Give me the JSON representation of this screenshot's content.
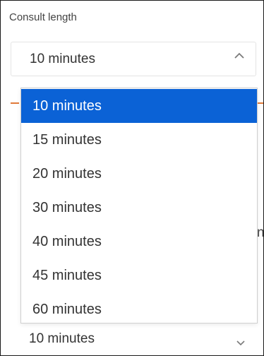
{
  "field": {
    "label": "Consult length",
    "selected_value": "10 minutes"
  },
  "dropdown": {
    "options": [
      "10 minutes",
      "15 minutes",
      "20 minutes",
      "30 minutes",
      "40 minutes",
      "45 minutes",
      "60 minutes"
    ],
    "highlighted_option": "10 minutes"
  },
  "background": {
    "clipped_text": "n",
    "next_select_value": "10 minutes"
  },
  "colors": {
    "highlight": "#0b62d6",
    "accent_line": "#e07a3a",
    "text": "#333333"
  },
  "icons": {
    "open_indicator": "chevron-up-icon",
    "closed_indicator": "chevron-down-icon"
  }
}
